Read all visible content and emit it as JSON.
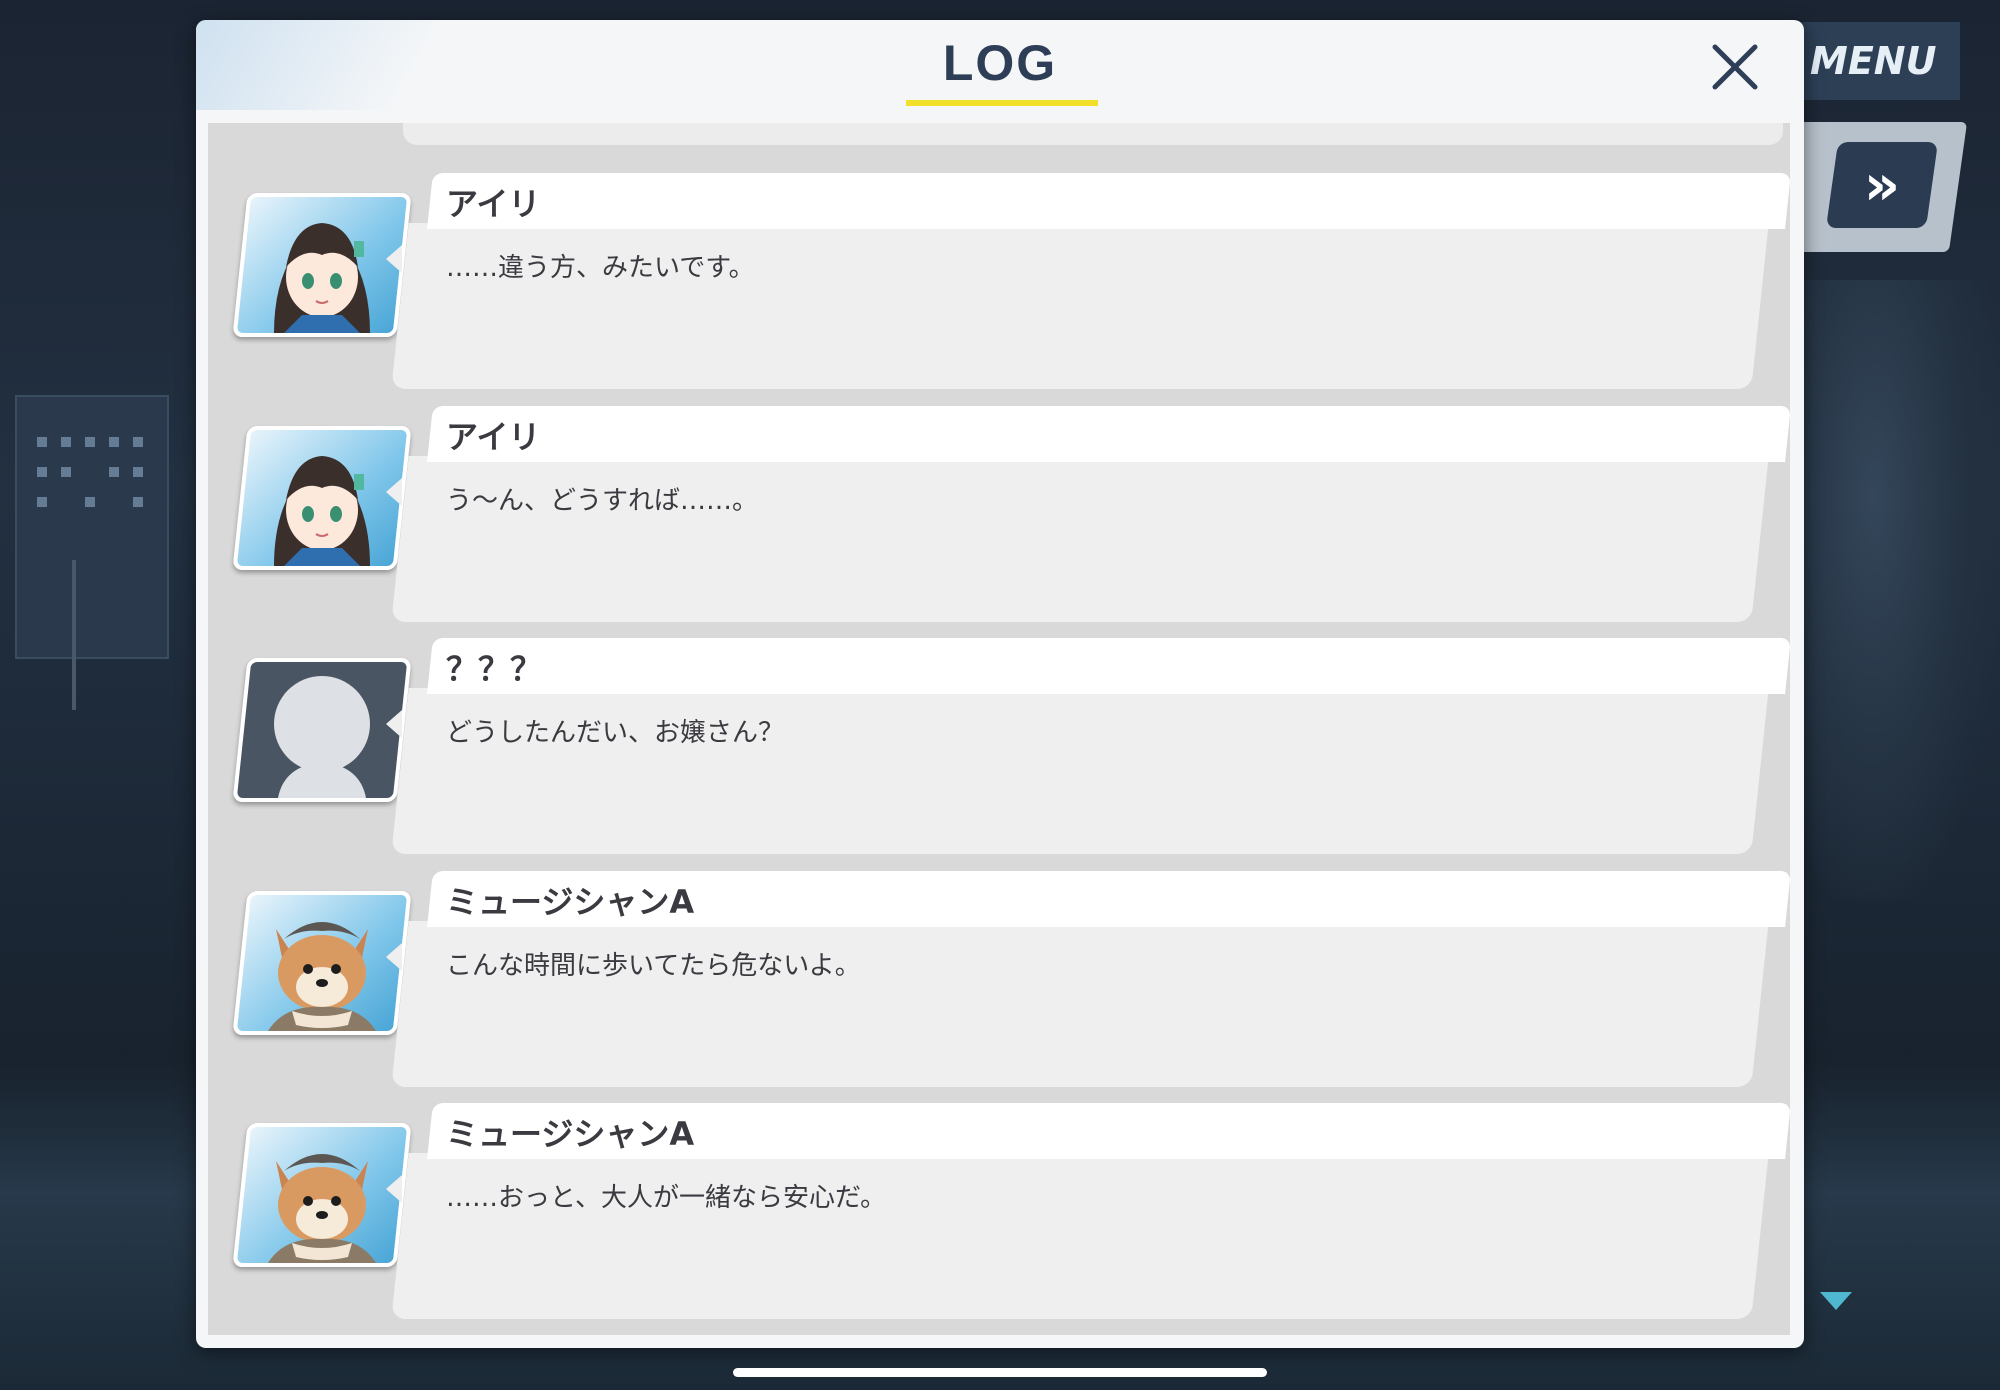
{
  "header": {
    "title": "LOG"
  },
  "menu_button": {
    "label": "MENU"
  },
  "fast_forward": {
    "glyph": "»"
  },
  "log_entries": [
    {
      "speaker": "アイリ",
      "text": "……違う方、みたいです。",
      "avatar": "airi-portrait"
    },
    {
      "speaker": "アイリ",
      "text": "う～ん、どうすれば……。",
      "avatar": "airi-portrait"
    },
    {
      "speaker": "？？？",
      "text": "どうしたんだい、お嬢さん？",
      "avatar": "unknown-silhouette"
    },
    {
      "speaker": "ミュージシャンA",
      "text": "こんな時間に歩いてたら危ないよ。",
      "avatar": "dog-musician-portrait"
    },
    {
      "speaker": "ミュージシャンA",
      "text": "……おっと、大人が一緒なら安心だ。",
      "avatar": "dog-musician-portrait"
    }
  ],
  "colors": {
    "title_text": "#2e3e57",
    "title_underline": "#f0e02a",
    "menu_bg": "#2c3f55",
    "scroll_indicator": "#4fb8d0"
  }
}
